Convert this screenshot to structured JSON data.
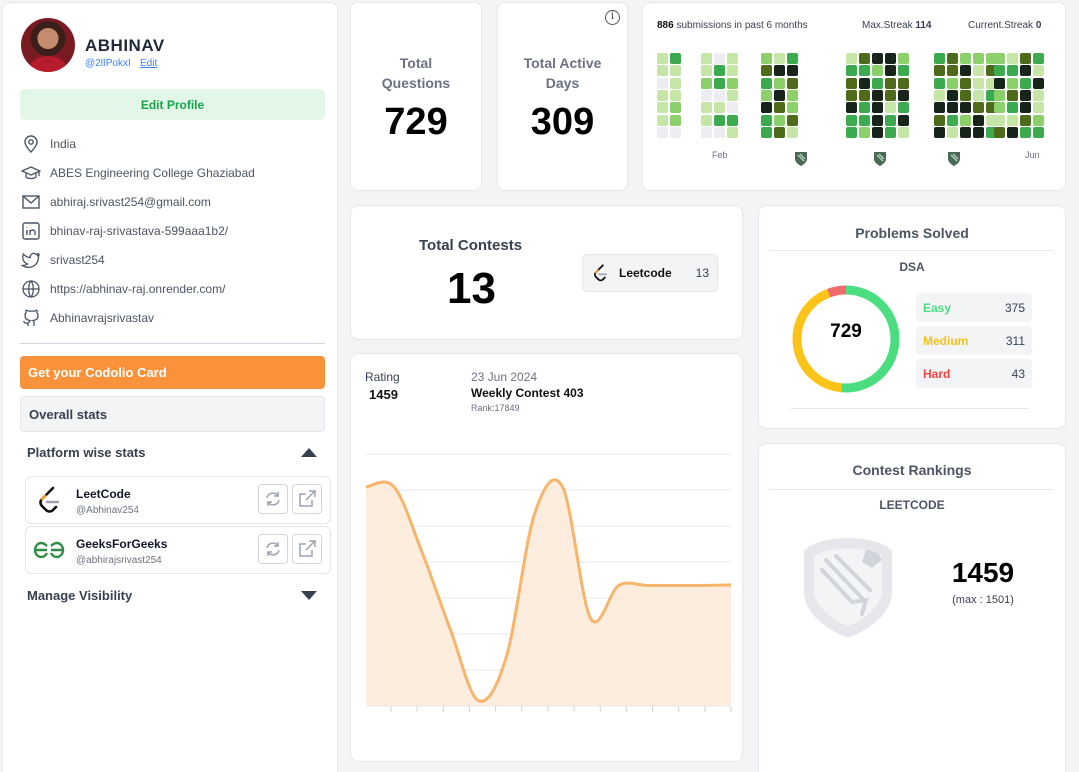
{
  "profile": {
    "name": "ABHINAV",
    "handle": "@2lIPokxI",
    "edit_label": "Edit",
    "edit_profile_label": "Edit Profile",
    "country": "India",
    "college": "ABES Engineering College Ghaziabad",
    "email": "abhiraj.srivast254@gmail.com",
    "linkedin": "bhinav-raj-srivastava-599aaa1b2/",
    "twitter": "srivast254",
    "website": "https://abhinav-raj.onrender.com/",
    "github": "Abhinavrajsrivastav"
  },
  "sidebar": {
    "card_button": "Get your Codolio Card",
    "overall_stats": "Overall stats",
    "platform_stats": "Platform wise stats",
    "manage_visibility": "Manage Visibility",
    "platforms": [
      {
        "name": "LeetCode",
        "user": "@Abhinav254"
      },
      {
        "name": "GeeksForGeeks",
        "user": "@abhirajsrivast254"
      }
    ]
  },
  "stats": {
    "total_questions_label": "Total Questions",
    "total_questions": "729",
    "active_days_label": "Total Active Days",
    "active_days": "309",
    "info_icon": "i"
  },
  "heatmap": {
    "submissions_count": "886",
    "submissions_text": "submissions in past 6 months",
    "max_streak_label": "Max.Streak",
    "max_streak": "114",
    "current_streak_label": "Current.Streak",
    "current_streak": "0",
    "months": [
      "Feb",
      "Jun"
    ],
    "colors": [
      "#ebedf0",
      "#c5e6a6",
      "#8bd06a",
      "#3cab4f",
      "#4e6b1c",
      "#17241a"
    ]
  },
  "contests": {
    "label": "Total Contests",
    "value": "13",
    "platform": "Leetcode",
    "platform_count": "13"
  },
  "rating": {
    "label": "Rating",
    "value": "1459",
    "date": "23 Jun 2024",
    "contest": "Weekly Contest 403",
    "rank": "Rank:17849",
    "line_color": "#f7b46b",
    "fill_color": "#fde9d6"
  },
  "chart_data": {
    "type": "area",
    "values": [
      1640,
      1640,
      1520,
      1380,
      1250,
      1330,
      1590,
      1640,
      1400,
      1460,
      1460,
      1460,
      1460,
      1461
    ],
    "ylim": [
      1240,
      1700
    ],
    "title": "",
    "xlabel": "",
    "ylabel": ""
  },
  "problems": {
    "title": "Problems Solved",
    "category": "DSA",
    "total": "729",
    "easy_label": "Easy",
    "easy": 375,
    "easy_color": "#4ade80",
    "medium_label": "Medium",
    "medium": 311,
    "medium_color": "#facc15",
    "hard_label": "Hard",
    "hard": 43,
    "hard_color": "#ef4444"
  },
  "rankings": {
    "title": "Contest Rankings",
    "platform": "LEETCODE",
    "rating": "1459",
    "max_text": "(max : 1501)"
  }
}
